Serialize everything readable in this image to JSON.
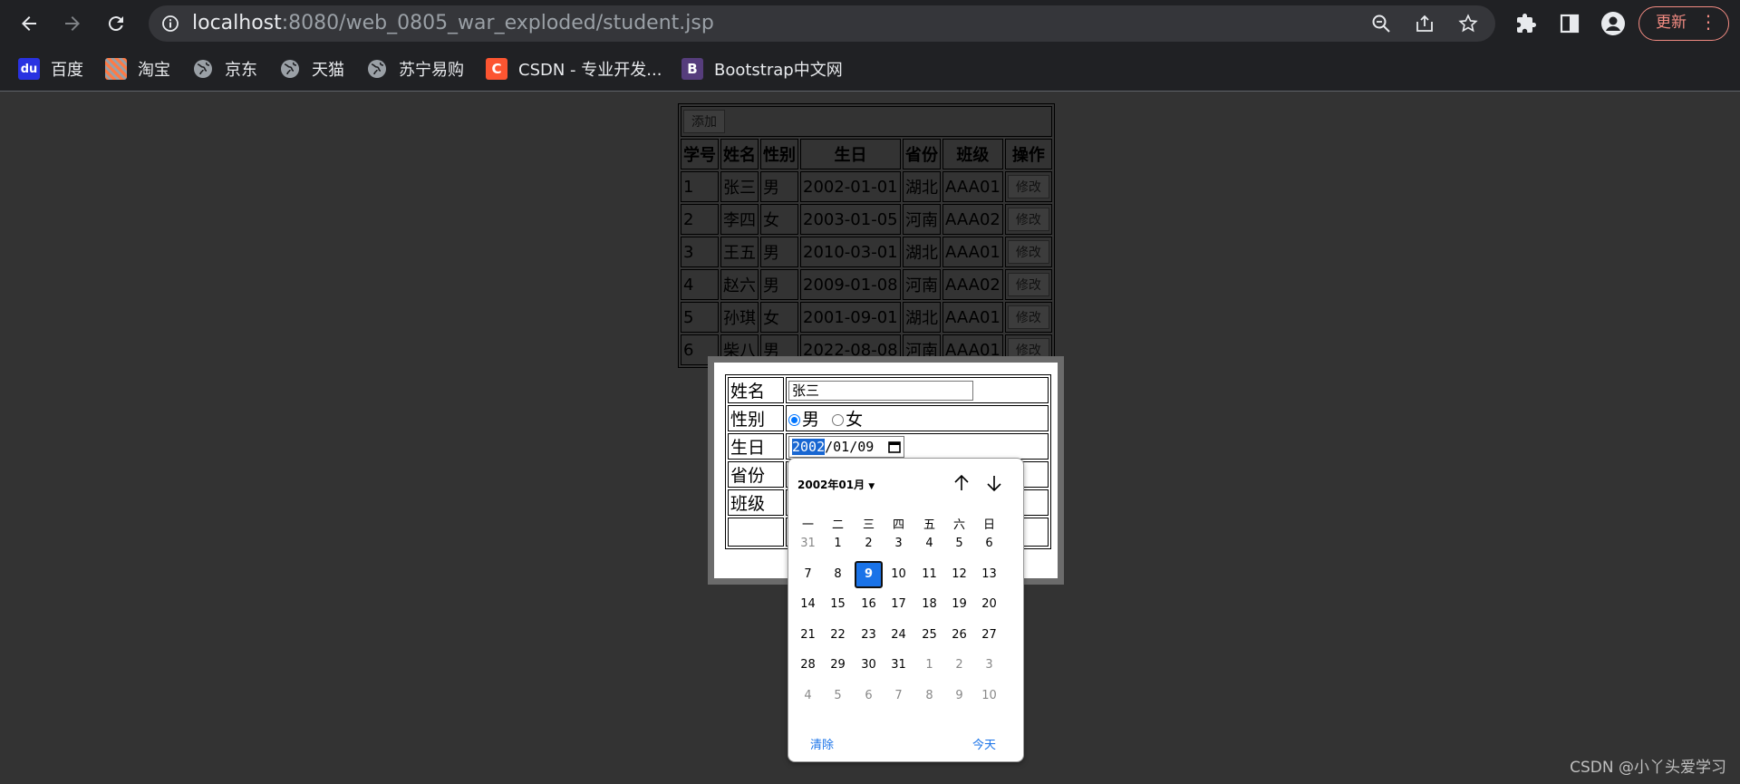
{
  "browser": {
    "url_host": "localhost",
    "url_path": ":8080/web_0805_war_exploded/student.jsp",
    "update_label": "更新",
    "bookmarks": [
      {
        "label": "百度",
        "icon": "baidu-icon"
      },
      {
        "label": "淘宝",
        "icon": "taobao-icon"
      },
      {
        "label": "京东",
        "icon": "globe-icon"
      },
      {
        "label": "天猫",
        "icon": "globe-icon"
      },
      {
        "label": "苏宁易购",
        "icon": "globe-icon"
      },
      {
        "label": "CSDN - 专业开发...",
        "icon": "csdn-icon"
      },
      {
        "label": "Bootstrap中文网",
        "icon": "bootstrap-icon"
      }
    ]
  },
  "student_table": {
    "add_label": "添加",
    "headers": [
      "学号",
      "姓名",
      "性别",
      "生日",
      "省份",
      "班级",
      "操作"
    ],
    "edit_label": "修改",
    "rows": [
      {
        "id": "1",
        "name": "张三",
        "gender": "男",
        "birthday": "2002-01-01",
        "province": "湖北",
        "class": "AAA01"
      },
      {
        "id": "2",
        "name": "李四",
        "gender": "女",
        "birthday": "2003-01-05",
        "province": "河南",
        "class": "AAA02"
      },
      {
        "id": "3",
        "name": "王五",
        "gender": "男",
        "birthday": "2010-03-01",
        "province": "湖北",
        "class": "AAA01"
      },
      {
        "id": "4",
        "name": "赵六",
        "gender": "男",
        "birthday": "2009-01-08",
        "province": "河南",
        "class": "AAA02"
      },
      {
        "id": "5",
        "name": "孙琪",
        "gender": "女",
        "birthday": "2001-09-01",
        "province": "湖北",
        "class": "AAA01"
      },
      {
        "id": "6",
        "name": "柴八",
        "gender": "男",
        "birthday": "2022-08-08",
        "province": "河南",
        "class": "AAA01"
      }
    ]
  },
  "edit_form": {
    "name_label": "姓名",
    "name_value": "张三",
    "gender_label": "性别",
    "gender_male": "男",
    "gender_female": "女",
    "birthday_label": "生日",
    "birthday_year": "2002",
    "birthday_rest": "/01/09",
    "province_label": "省份",
    "class_label": "班级"
  },
  "date_picker": {
    "month_label": "2002年01月",
    "weekdays": [
      "一",
      "二",
      "三",
      "四",
      "五",
      "六",
      "日"
    ],
    "weeks": [
      [
        [
          "31",
          true
        ],
        [
          "1",
          false
        ],
        [
          "2",
          false
        ],
        [
          "3",
          false
        ],
        [
          "4",
          false
        ],
        [
          "5",
          false
        ],
        [
          "6",
          false
        ]
      ],
      [
        [
          "7",
          false
        ],
        [
          "8",
          false
        ],
        [
          "9",
          false
        ],
        [
          "10",
          false
        ],
        [
          "11",
          false
        ],
        [
          "12",
          false
        ],
        [
          "13",
          false
        ]
      ],
      [
        [
          "14",
          false
        ],
        [
          "15",
          false
        ],
        [
          "16",
          false
        ],
        [
          "17",
          false
        ],
        [
          "18",
          false
        ],
        [
          "19",
          false
        ],
        [
          "20",
          false
        ]
      ],
      [
        [
          "21",
          false
        ],
        [
          "22",
          false
        ],
        [
          "23",
          false
        ],
        [
          "24",
          false
        ],
        [
          "25",
          false
        ],
        [
          "26",
          false
        ],
        [
          "27",
          false
        ]
      ],
      [
        [
          "28",
          false
        ],
        [
          "29",
          false
        ],
        [
          "30",
          false
        ],
        [
          "31",
          false
        ],
        [
          "1",
          true
        ],
        [
          "2",
          true
        ],
        [
          "3",
          true
        ]
      ],
      [
        [
          "4",
          true
        ],
        [
          "5",
          true
        ],
        [
          "6",
          true
        ],
        [
          "7",
          true
        ],
        [
          "8",
          true
        ],
        [
          "9",
          true
        ],
        [
          "10",
          true
        ]
      ]
    ],
    "selected_day": "9",
    "clear_label": "清除",
    "today_label": "今天"
  },
  "watermark": "CSDN @小丫头爱学习"
}
